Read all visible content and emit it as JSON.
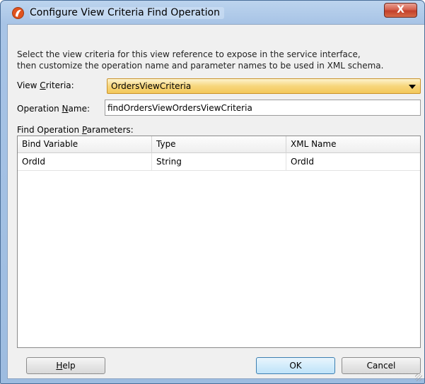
{
  "window": {
    "title": "Configure View Criteria Find Operation",
    "close_glyph": "X",
    "icon": "oracle-jdeveloper-icon"
  },
  "description": {
    "line1": "Select the view criteria for this view reference to expose in the service interface,",
    "line2": "then customize the operation name and parameter names to be used in XML schema."
  },
  "view_criteria": {
    "label_pre": "View ",
    "label_mnemonic": "C",
    "label_post": "riteria:",
    "selected": "OrdersViewCriteria"
  },
  "operation_name": {
    "label_pre": "Operation ",
    "label_mnemonic": "N",
    "label_post": "ame:",
    "value": "findOrdersViewOrdersViewCriteria"
  },
  "parameters": {
    "label_pre": "Find Operation ",
    "label_mnemonic": "P",
    "label_post": "arameters:",
    "columns": [
      "Bind Variable",
      "Type",
      "XML Name"
    ],
    "rows": [
      [
        "OrdId",
        "String",
        "OrdId"
      ]
    ]
  },
  "buttons": {
    "help_mnemonic": "H",
    "help_rest": "elp",
    "ok": "OK",
    "cancel": "Cancel"
  },
  "colors": {
    "title_bar": "#a8c4e6",
    "close_button": "#c3402a",
    "combo_highlight": "#f7d67c",
    "ok_focus": "#d3ecfb"
  }
}
